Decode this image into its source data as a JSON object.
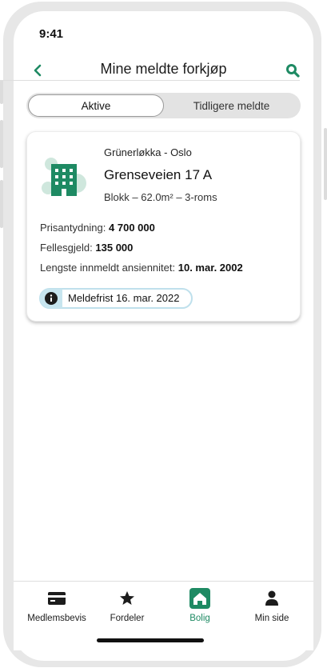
{
  "status_bar": {
    "time": "9:41"
  },
  "header": {
    "title": "Mine meldte forkjøp",
    "back_icon": "chevron-left-icon",
    "search_icon": "search-icon"
  },
  "tabs": [
    {
      "label": "Aktive",
      "active": true
    },
    {
      "label": "Tidligere meldte",
      "active": false
    }
  ],
  "listing": {
    "district": "Grünerløkka - Oslo",
    "address": "Grenseveien 17 A",
    "type": "Blokk – 62.0m² – 3-roms",
    "price_label": "Prisantydning:",
    "price_value": "4 700 000",
    "common_label": "Fellesgjeld:",
    "common_value": "135 000",
    "seniority_label": "Lengste innmeldt ansiennitet:",
    "seniority_value": "10. mar. 2002",
    "deadline_text": "Meldefrist 16. mar. 2022",
    "icon": "apartment-building-icon"
  },
  "bottom_nav": [
    {
      "label": "Medlemsbevis",
      "icon": "membership-card-icon",
      "active": false
    },
    {
      "label": "Fordeler",
      "icon": "star-icon",
      "active": false
    },
    {
      "label": "Bolig",
      "icon": "home-icon",
      "active": true
    },
    {
      "label": "Min side",
      "icon": "person-icon",
      "active": false
    }
  ],
  "colors": {
    "accent": "#1e8a63",
    "info": "#c7e5ef",
    "text": "#1c1c1c"
  }
}
